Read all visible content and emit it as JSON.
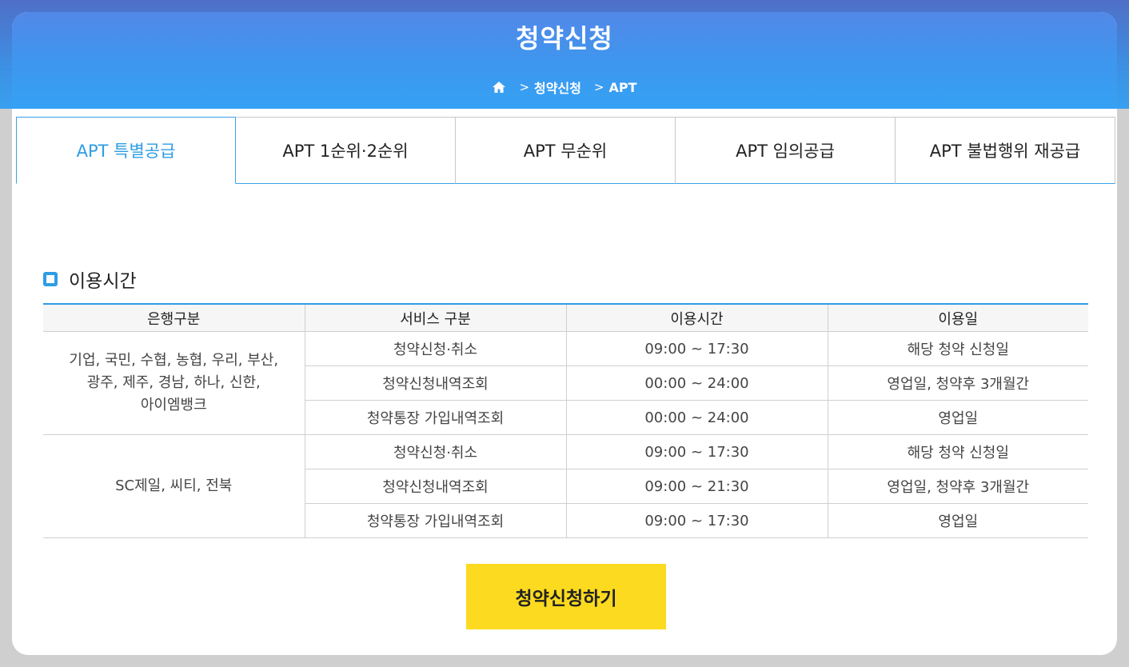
{
  "header": {
    "title": "청약신청",
    "breadcrumb": [
      "청약신청",
      "APT"
    ]
  },
  "tabs": [
    {
      "label": "APT 특별공급",
      "active": true
    },
    {
      "label": "APT 1순위·2순위",
      "active": false
    },
    {
      "label": "APT 무순위",
      "active": false
    },
    {
      "label": "APT 임의공급",
      "active": false
    },
    {
      "label": "APT 불법행위 재공급",
      "active": false
    }
  ],
  "section": {
    "title": "이용시간"
  },
  "table": {
    "headers": [
      "은행구분",
      "서비스 구분",
      "이용시간",
      "이용일"
    ],
    "groups": [
      {
        "banks": [
          "기업, 국민, 수협, 농협, 우리, 부산,",
          "광주, 제주, 경남, 하나, 신한,",
          "아이엠뱅크"
        ],
        "rows": [
          {
            "service": "청약신청·취소",
            "time": "09:00 ~ 17:30",
            "days": "해당 청약 신청일"
          },
          {
            "service": "청약신청내역조회",
            "time": "00:00 ~ 24:00",
            "days": "영업일, 청약후 3개월간"
          },
          {
            "service": "청약통장 가입내역조회",
            "time": "00:00 ~ 24:00",
            "days": "영업일"
          }
        ]
      },
      {
        "banks": [
          "SC제일, 씨티, 전북"
        ],
        "rows": [
          {
            "service": "청약신청·취소",
            "time": "09:00 ~ 17:30",
            "days": "해당 청약 신청일"
          },
          {
            "service": "청약신청내역조회",
            "time": "09:00 ~ 21:30",
            "days": "영업일, 청약후 3개월간"
          },
          {
            "service": "청약통장 가입내역조회",
            "time": "09:00 ~ 17:30",
            "days": "영업일"
          }
        ]
      }
    ]
  },
  "apply_button": {
    "label": "청약신청하기",
    "color": "#fcda1f"
  },
  "colors": {
    "accent": "#2f9de3",
    "header_top": "#5288e8",
    "header_bottom": "#35a2f4"
  }
}
